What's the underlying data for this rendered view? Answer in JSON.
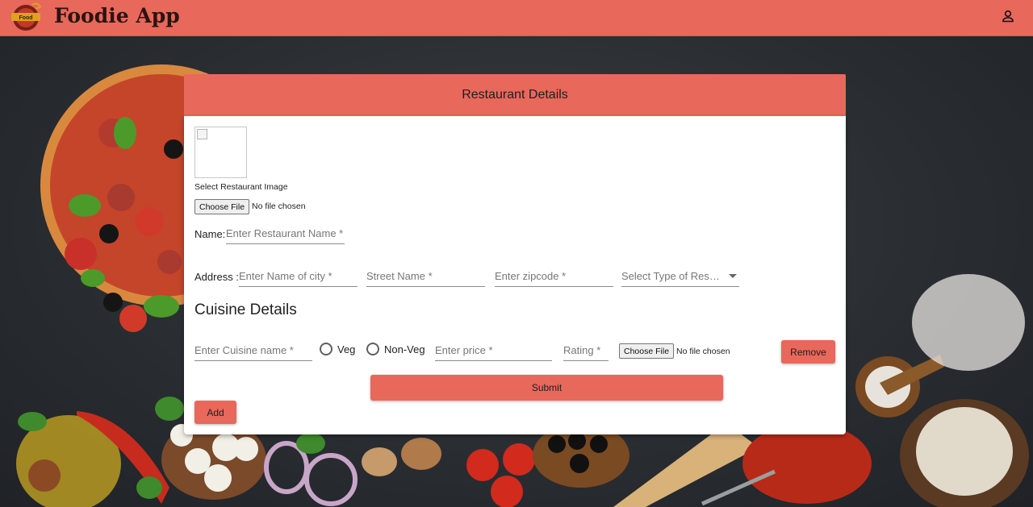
{
  "header": {
    "logo_text": "Food",
    "brand": "Foodie App",
    "user_icon": "person-icon",
    "color": "#e8685b"
  },
  "card": {
    "title": "Restaurant Details",
    "image": {
      "caption": "Select Restaurant Image",
      "choose_file_label": "Choose File",
      "file_status": "No file chosen"
    },
    "name": {
      "label": "Name:",
      "placeholder": "Enter Restaurant Name *"
    },
    "address": {
      "label": "Address :",
      "city_placeholder": "Enter Name of city *",
      "street_placeholder": "Street Name *",
      "zip_placeholder": "Enter zipcode *",
      "type_select": "Select Type of Restaurant"
    },
    "cuisine": {
      "section_title": "Cuisine Details",
      "name_placeholder": "Enter Cuisine name *",
      "veg_label": "Veg",
      "nonveg_label": "Non-Veg",
      "price_placeholder": "Enter price *",
      "rating_placeholder": "Rating *",
      "choose_file_label": "Choose File",
      "file_status": "No file chosen",
      "remove_label": "Remove"
    },
    "submit_label": "Submit",
    "add_label": "Add"
  }
}
